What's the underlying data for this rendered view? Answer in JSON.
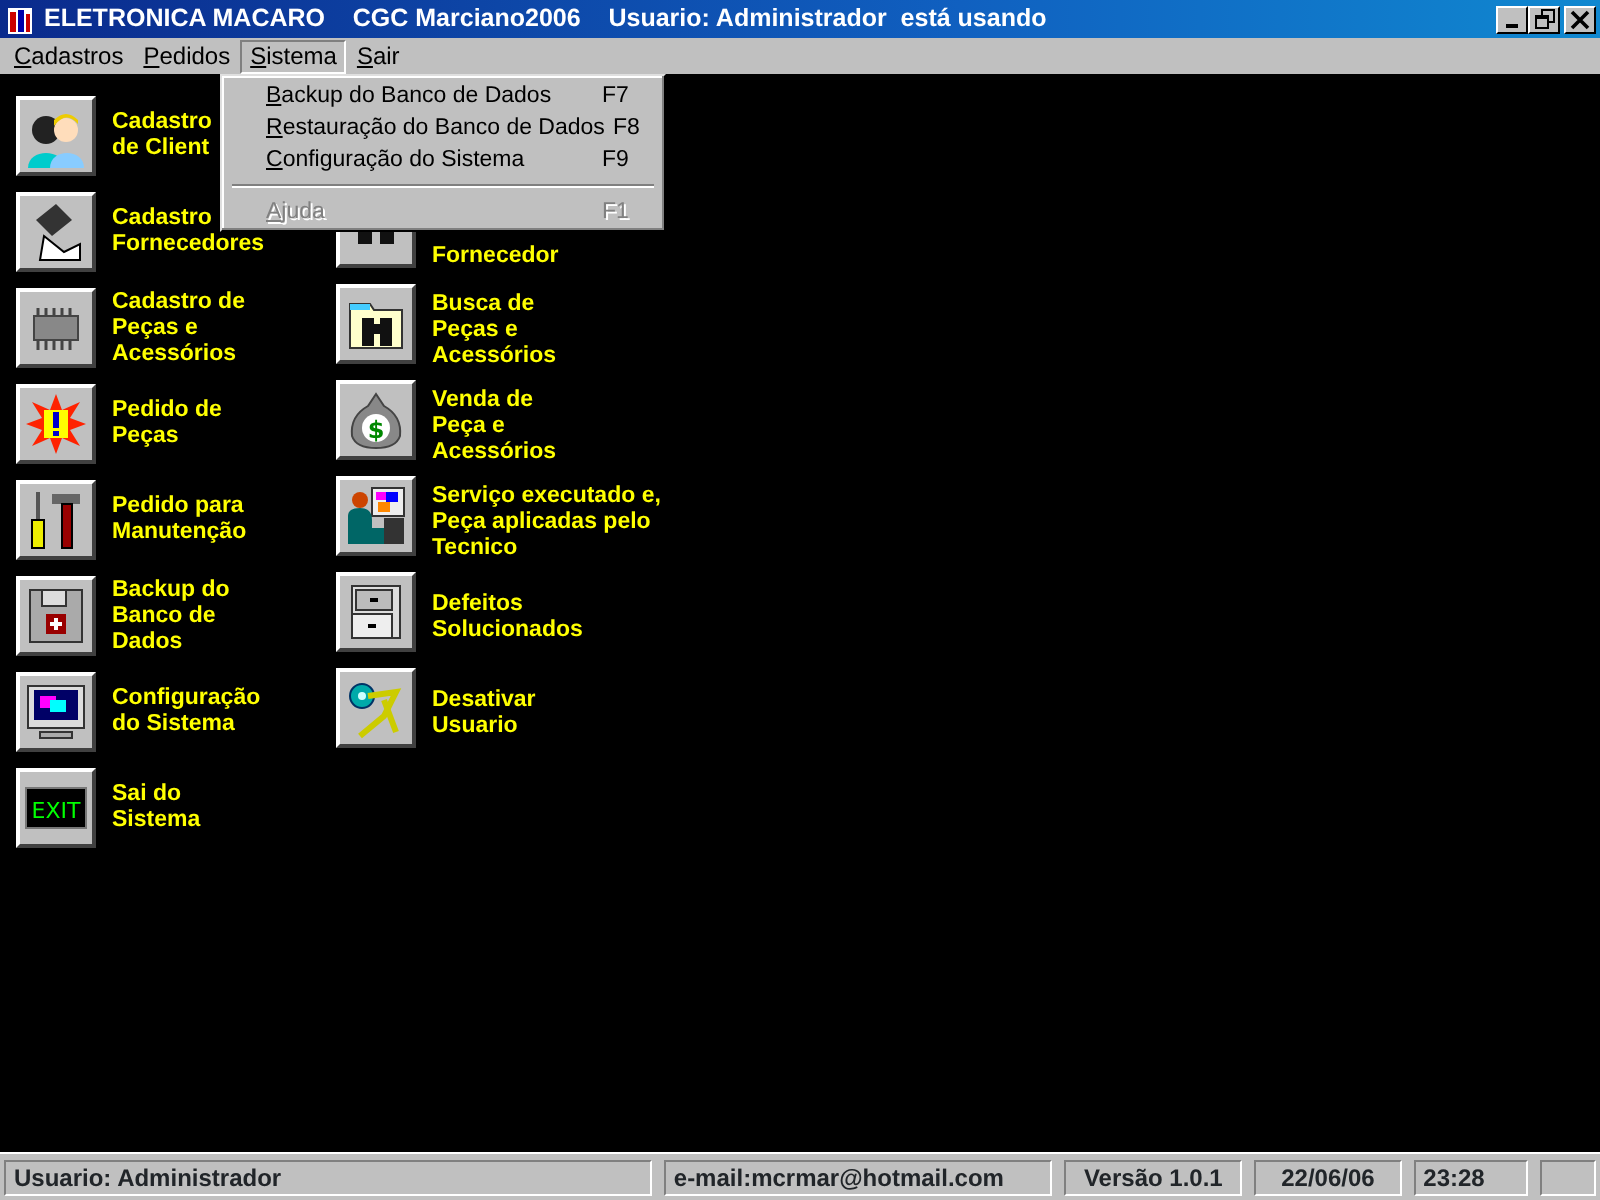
{
  "window": {
    "title": "ELETRONICA MACARO    CGC Marciano2006    Usuario: Administrador  está usando"
  },
  "menu_bar": [
    {
      "label": "Cadastros",
      "selected": false
    },
    {
      "label": "Pedidos",
      "selected": false
    },
    {
      "label": "Sistema",
      "selected": true
    },
    {
      "label": "Sair",
      "selected": false
    }
  ],
  "dropdown": {
    "items": [
      {
        "kind": "item",
        "label": "Backup do Banco de Dados",
        "shortcut": "F7",
        "disabled": false
      },
      {
        "kind": "item",
        "label": "Restauração do Banco de Dados",
        "shortcut": "F8",
        "disabled": false
      },
      {
        "kind": "item",
        "label": "Configuração do Sistema",
        "shortcut": "F9",
        "disabled": false
      },
      {
        "kind": "separator"
      },
      {
        "kind": "item",
        "label": "Ajuda",
        "shortcut": "F1",
        "disabled": true
      }
    ]
  },
  "launcher": {
    "columns": [
      {
        "items": [
          {
            "kind": "full",
            "lines": [
              "Cadastro",
              "de Client"
            ]
          },
          {
            "kind": "full",
            "lines": [
              "Cadastro",
              "Fornecedores"
            ]
          },
          {
            "kind": "full",
            "lines": [
              "Cadastro de",
              "Peças e",
              "Acessórios"
            ]
          },
          {
            "kind": "full",
            "lines": [
              "Pedido de",
              "Peças"
            ]
          },
          {
            "kind": "full",
            "lines": [
              "Pedido para",
              "Manutenção"
            ]
          },
          {
            "kind": "full",
            "lines": [
              "Backup do",
              "Banco de",
              "Dados"
            ]
          },
          {
            "kind": "full",
            "lines": [
              "Configuração",
              "do Sistema"
            ]
          },
          {
            "kind": "full",
            "lines": [
              "Sai do",
              "Sistema"
            ],
            "sign": "EXIT"
          }
        ]
      },
      {
        "items": [
          {
            "kind": "covered",
            "lines": [
              "Fornecedor"
            ]
          },
          {
            "kind": "full",
            "lines": [
              "Busca de",
              "Peças e",
              "Acessórios"
            ]
          },
          {
            "kind": "full",
            "lines": [
              "Venda de",
              "Peça e",
              "Acessórios"
            ],
            "sign": "$"
          },
          {
            "kind": "full",
            "lines": [
              "Serviço executado e,",
              "Peça aplicadas pelo",
              "Tecnico"
            ]
          },
          {
            "kind": "full",
            "lines": [
              "Defeitos",
              "Solucionados"
            ]
          },
          {
            "kind": "full",
            "lines": [
              "Desativar",
              "Usuario"
            ]
          }
        ]
      }
    ]
  },
  "status_bar": [
    "Usuario: Administrador",
    "e-mail:mcrmar@hotmail.com",
    "Versão 1.0.1",
    "22/06/06",
    "23:28"
  ]
}
